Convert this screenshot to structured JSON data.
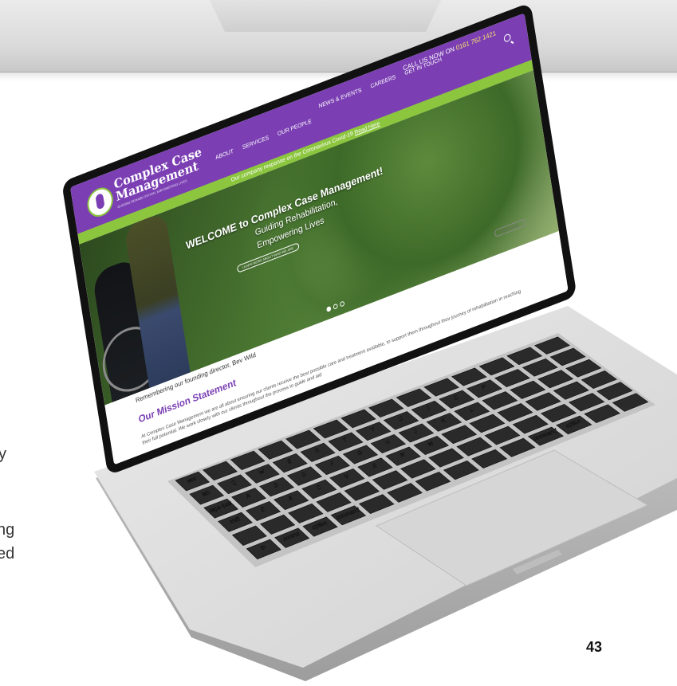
{
  "page": {
    "number": "43",
    "left_fragments": [
      "y",
      "ng",
      "ed"
    ]
  },
  "website": {
    "logo": {
      "name": "Complex Case Management",
      "tagline": "GUIDING REHABILITATION, EMPOWERING LIVES"
    },
    "call_prefix": "CALL US NOW ON",
    "phone": "0161 762 1421",
    "nav": [
      "ABOUT",
      "SERVICES",
      "OUR PEOPLE",
      "NEWS & EVENTS",
      "CAREERS",
      "GET IN TOUCH"
    ],
    "banner": {
      "text": "Our company response on the Coronavirus Covid-19",
      "link": "Read Here"
    },
    "hero": {
      "title": "WELCOME to Complex Case Management!",
      "subtitle_line1": "Guiding Rehabilitation,",
      "subtitle_line2": "Empowering Lives",
      "cta": "LEARN MORE ABOUT WHO WE ARE",
      "read_more": "READ MORE"
    },
    "remember_text": "Remembering our founding director, Bev Wild",
    "mission": {
      "title": "Our Mission Statement",
      "text": "At Complex Case Management we are all about ensuring our clients receive the best possible care and treatment available, to support them throughout their journey of rehabilitation in reaching their full potential. We work closely with our clients throughout the process to guide and aid"
    }
  },
  "keyboard": {
    "keys": [
      "esc",
      "tab",
      "caps lock",
      "shift",
      "fn",
      "control",
      "option",
      "command",
      "command",
      "option",
      "Q",
      "W",
      "E",
      "R",
      "T",
      "Y",
      "U",
      "I",
      "O",
      "P",
      "A",
      "S",
      "D",
      "F",
      "G",
      "H",
      "J",
      "K",
      "L",
      "Z",
      "X",
      "C",
      "V",
      "B",
      "N",
      "M"
    ]
  }
}
